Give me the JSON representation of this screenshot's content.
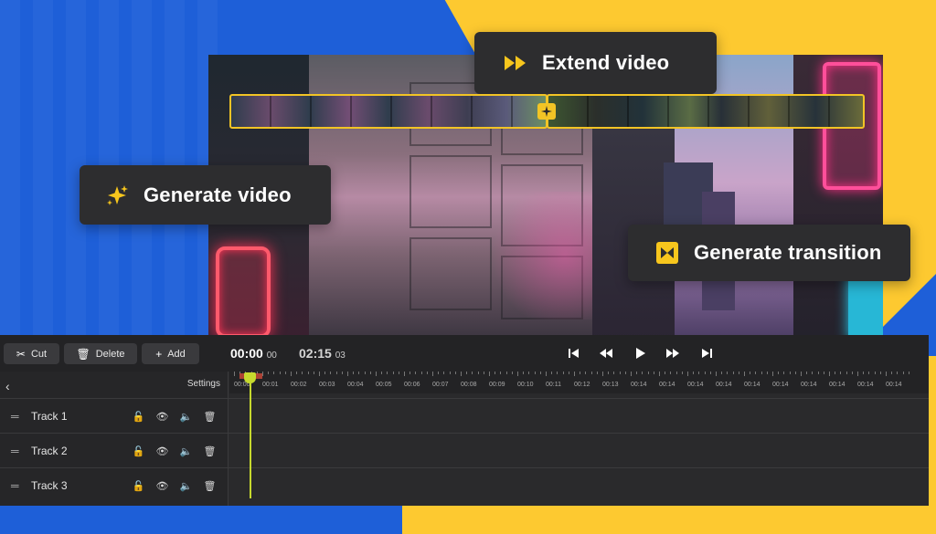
{
  "hero": {
    "extend_label": "Extend video",
    "generate_label": "Generate video",
    "transition_label": "Generate transition"
  },
  "toolbar": {
    "cut_label": "Cut",
    "delete_label": "Delete",
    "add_label": "Add",
    "current_time": "00:00",
    "current_frames": "00",
    "total_time": "02:15",
    "total_frames": "03"
  },
  "panel": {
    "settings_label": "Settings",
    "tracks": [
      {
        "name": "Track 1"
      },
      {
        "name": "Track 2"
      },
      {
        "name": "Track 3"
      }
    ]
  },
  "ruler": {
    "labels": [
      "00:00",
      "00:01",
      "00:02",
      "00:03",
      "00:04",
      "00:05",
      "00:06",
      "00:07",
      "00:08",
      "00:09",
      "00:10",
      "00:11",
      "00:12",
      "00:13",
      "00:14",
      "00:14",
      "00:14",
      "00:14",
      "00:14",
      "00:14",
      "00:14",
      "00:14",
      "00:14",
      "00:14"
    ]
  },
  "colors": {
    "accent_yellow": "#f2c425",
    "background_blue": "#1e5fd8",
    "background_yellow": "#fdc930",
    "playhead": "#c6d92e"
  }
}
